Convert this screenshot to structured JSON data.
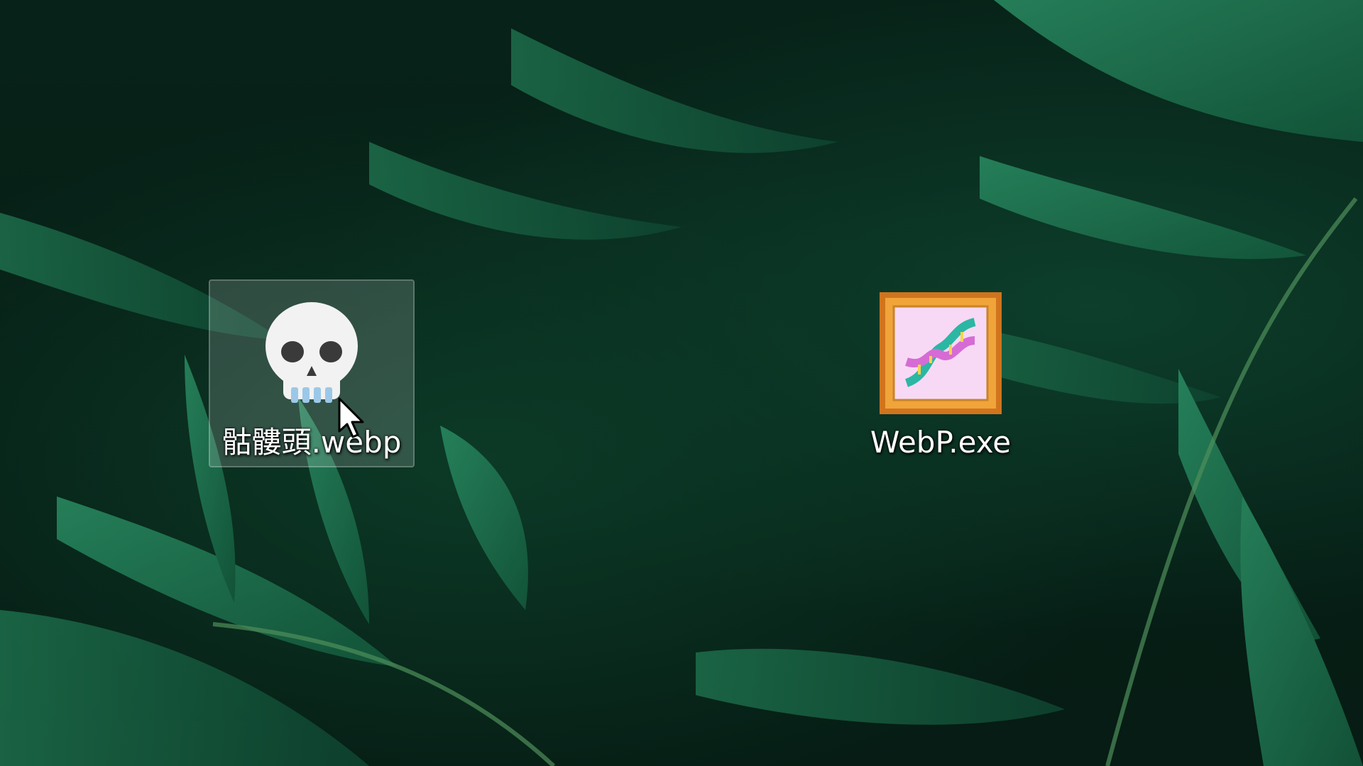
{
  "desktop": {
    "icons": [
      {
        "label": "骷髏頭.webp",
        "icon": "skull-icon",
        "selected": true
      },
      {
        "label": "WebP.exe",
        "icon": "dna-frame-icon",
        "selected": false
      }
    ]
  },
  "colors": {
    "wallpaper": "#071f17",
    "fern": "#1f7a55",
    "selection": "rgba(255,255,255,0.16)",
    "frame_orange": "#e8952a",
    "frame_inner": "#f2c6ef"
  },
  "cursor": {
    "type": "arrow-pointer-icon"
  }
}
